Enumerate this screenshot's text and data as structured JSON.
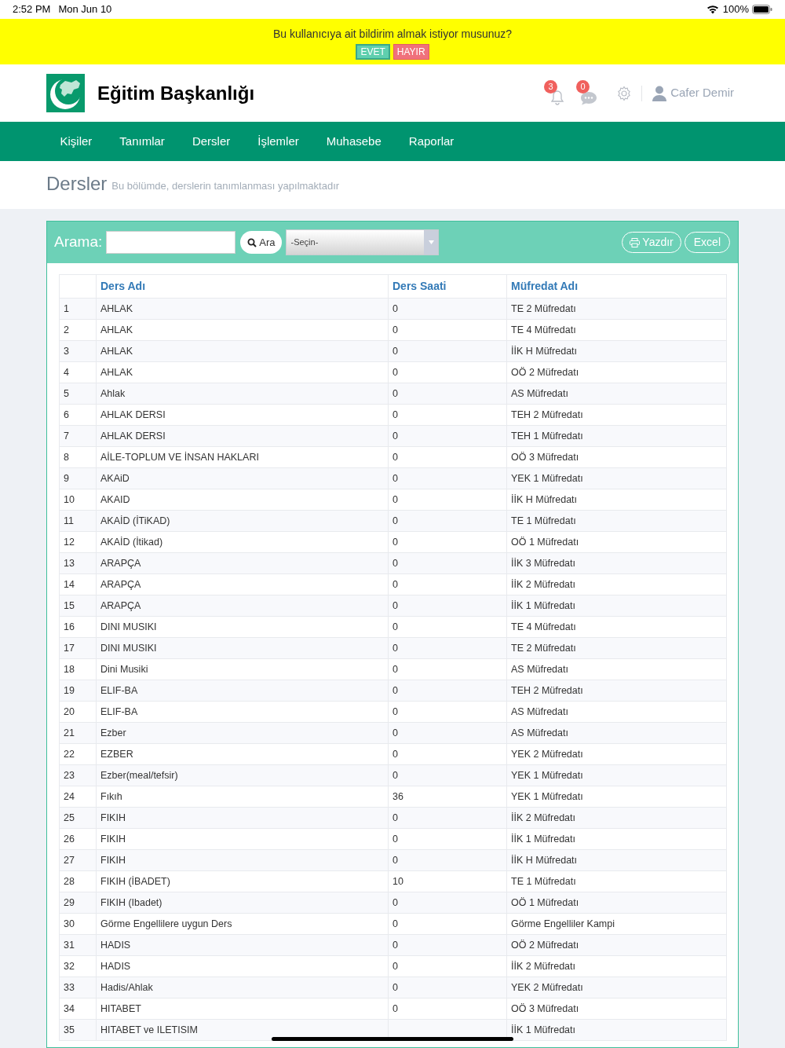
{
  "status_bar": {
    "time": "2:52 PM",
    "date": "Mon Jun 10",
    "battery": "100%"
  },
  "banner": {
    "message": "Bu kullanıcıya ait bildirim almak istiyor musunuz?",
    "buttons": [
      {
        "label": "EVET",
        "kind": "yes"
      },
      {
        "label": "HAYIR",
        "kind": "no"
      }
    ]
  },
  "header": {
    "title": "Eğitim Başkanlığı",
    "notifications": "3",
    "messages": "0",
    "user": "Cafer Demir"
  },
  "nav": {
    "items": [
      "Kişiler",
      "Tanımlar",
      "Dersler",
      "İşlemler",
      "Muhasebe",
      "Raporlar"
    ]
  },
  "page": {
    "title": "Dersler",
    "subtitle": "Bu bölümde, derslerin tanımlanması yapılmaktadır"
  },
  "toolbar": {
    "search_label": "Arama:",
    "search_button": "Ara",
    "select": "-Seçin-",
    "print_button": "Yazdır",
    "excel_button": "Excel"
  },
  "table": {
    "columns": [
      "",
      "Ders Adı",
      "Ders Saati",
      "Müfredat Adı"
    ],
    "rows": [
      [
        "1",
        "AHLAK",
        "0",
        "TE 2 Müfredatı"
      ],
      [
        "2",
        "AHLAK",
        "0",
        "TE 4 Müfredatı"
      ],
      [
        "3",
        "AHLAK",
        "0",
        "İİK H Müfredatı"
      ],
      [
        "4",
        "AHLAK",
        "0",
        "OÖ 2 Müfredatı"
      ],
      [
        "5",
        "Ahlak",
        "0",
        "AS Müfredatı"
      ],
      [
        "6",
        "AHLAK DERSI",
        "0",
        "TEH 2 Müfredatı"
      ],
      [
        "7",
        "AHLAK DERSI",
        "0",
        "TEH 1 Müfredatı"
      ],
      [
        "8",
        "AİLE-TOPLUM VE İNSAN HAKLARI",
        "0",
        "OÖ 3 Müfredatı"
      ],
      [
        "9",
        "AKAiD",
        "0",
        "YEK 1 Müfredatı"
      ],
      [
        "10",
        "AKAID",
        "0",
        "İİK H Müfredatı"
      ],
      [
        "11",
        "AKAİD (İTiKAD)",
        "0",
        "TE 1 Müfredatı"
      ],
      [
        "12",
        "AKAİD (İtikad)",
        "0",
        "OÖ 1 Müfredatı"
      ],
      [
        "13",
        "ARAPÇA",
        "0",
        "İİK 3 Müfredatı"
      ],
      [
        "14",
        "ARAPÇA",
        "0",
        "İİK 2 Müfredatı"
      ],
      [
        "15",
        "ARAPÇA",
        "0",
        "İİK 1 Müfredatı"
      ],
      [
        "16",
        "DINI MUSIKI",
        "0",
        "TE 4 Müfredatı"
      ],
      [
        "17",
        "DINI MUSIKI",
        "0",
        "TE 2 Müfredatı"
      ],
      [
        "18",
        "Dini Musiki",
        "0",
        "AS Müfredatı"
      ],
      [
        "19",
        "ELIF-BA",
        "0",
        "TEH 2 Müfredatı"
      ],
      [
        "20",
        "ELIF-BA",
        "0",
        "AS Müfredatı"
      ],
      [
        "21",
        "Ezber",
        "0",
        "AS Müfredatı"
      ],
      [
        "22",
        "EZBER",
        "0",
        "YEK 2 Müfredatı"
      ],
      [
        "23",
        "Ezber(meal/tefsir)",
        "0",
        "YEK 1 Müfredatı"
      ],
      [
        "24",
        "Fıkıh",
        "36",
        "YEK 1 Müfredatı"
      ],
      [
        "25",
        "FIKIH",
        "0",
        "İİK 2 Müfredatı"
      ],
      [
        "26",
        "FIKIH",
        "0",
        "İİK 1 Müfredatı"
      ],
      [
        "27",
        "FIKIH",
        "0",
        "İİK H Müfredatı"
      ],
      [
        "28",
        "FIKIH (İBADET)",
        "10",
        "TE 1 Müfredatı"
      ],
      [
        "29",
        "FIKIH (Ibadet)",
        "0",
        "OÖ 1 Müfredatı"
      ],
      [
        "30",
        "Görme Engellilere uygun Ders",
        "0",
        "Görme Engelliler Kampi"
      ],
      [
        "31",
        "HADIS",
        "0",
        "OÖ 2 Müfredatı"
      ],
      [
        "32",
        "HADIS",
        "0",
        "İİK 2 Müfredatı"
      ],
      [
        "33",
        "Hadis/Ahlak",
        "0",
        "YEK 2 Müfredatı"
      ],
      [
        "34",
        "HITABET",
        "0",
        "OÖ 3 Müfredatı"
      ],
      [
        "35",
        "HITABET ve ILETISIM",
        "",
        "İİK 1 Müfredatı"
      ]
    ]
  }
}
